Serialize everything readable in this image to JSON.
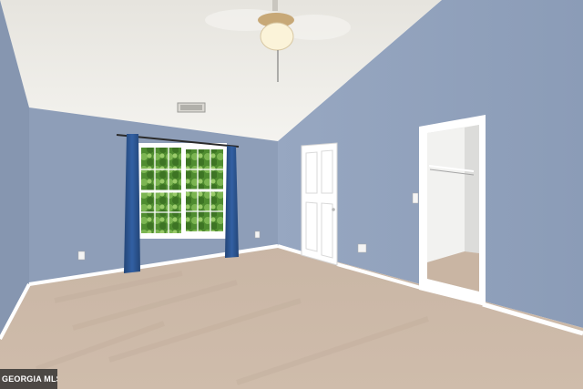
{
  "scene": {
    "subject": "empty-bedroom-interior",
    "elements": [
      "vaulted-ceiling",
      "ceiling-fan",
      "window-with-blue-curtains",
      "interior-door",
      "walk-in-closet",
      "carpet-floor"
    ]
  },
  "watermark": {
    "text": "GEORGIA MLS"
  },
  "colors": {
    "wall": "#8f9fb9",
    "wall_dark": "#7f90ab",
    "ceiling": "#eceae4",
    "carpet": "#cbb7a5",
    "trim": "#ffffff",
    "curtain": "#2c5290",
    "foliage": "#5c9a3a"
  }
}
